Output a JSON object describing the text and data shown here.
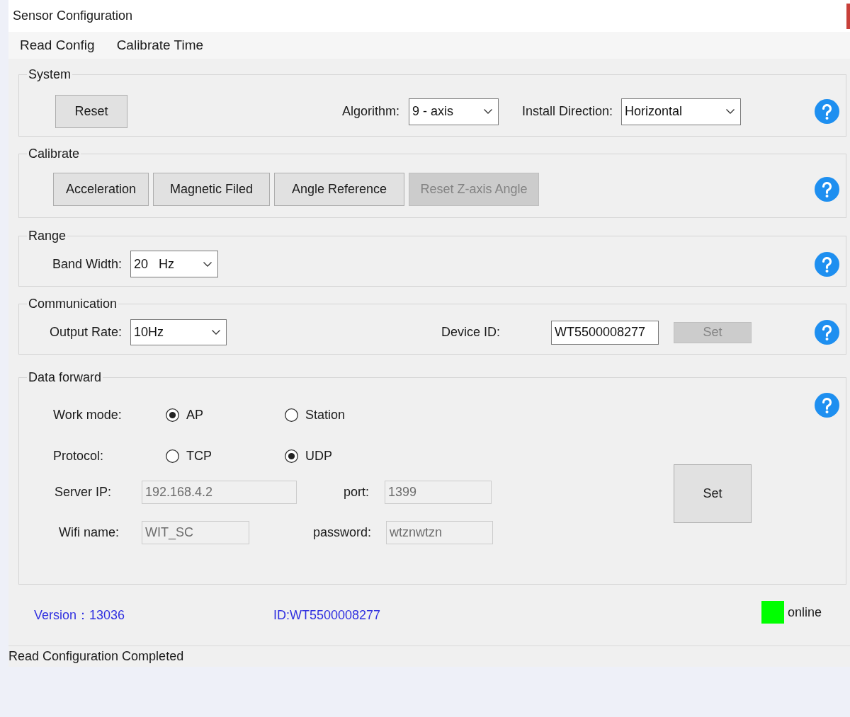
{
  "window": {
    "title": "Sensor Configuration"
  },
  "menu": [
    "Read Config",
    "Calibrate Time"
  ],
  "system": {
    "title": "System",
    "reset_button": {
      "label": "Reset",
      "disabled": false
    },
    "algorithm": {
      "label": "Algorithm:",
      "value": "9 - axis"
    },
    "install_direction": {
      "label": "Install Direction:",
      "value": "Horizontal"
    }
  },
  "calibrate": {
    "title": "Calibrate",
    "buttons": [
      {
        "label": "Acceleration",
        "disabled": false
      },
      {
        "label": "Magnetic Filed",
        "disabled": false
      },
      {
        "label": "Angle Reference",
        "disabled": false
      },
      {
        "label": "Reset Z-axis Angle",
        "disabled": true
      }
    ]
  },
  "range": {
    "title": "Range",
    "band_width": {
      "label": "Band Width:",
      "value": "20   Hz"
    }
  },
  "communication": {
    "title": "Communication",
    "output_rate": {
      "label": "Output Rate:",
      "value": "10Hz"
    },
    "device_id": {
      "label": "Device ID:",
      "value": "WT5500008277",
      "disabled": false
    },
    "set_button": {
      "label": "Set",
      "disabled": true
    }
  },
  "data_forward": {
    "title": "Data forward",
    "work_mode": {
      "label": "Work mode:",
      "options": [
        {
          "label": "AP",
          "selected": true
        },
        {
          "label": "Station",
          "selected": false
        }
      ]
    },
    "protocol": {
      "label": "Protocol:",
      "options": [
        {
          "label": "TCP",
          "selected": false
        },
        {
          "label": "UDP",
          "selected": true
        }
      ]
    },
    "server_ip": {
      "label": "Server IP:",
      "value": "192.168.4.2",
      "disabled": true
    },
    "port": {
      "label": "port:",
      "value": "1399",
      "disabled": true
    },
    "wifi_name": {
      "label": "Wifi name:",
      "value": "WIT_SC",
      "disabled": true
    },
    "password": {
      "label": "password:",
      "value": "wtznwtzn",
      "disabled": true
    },
    "set_button": {
      "label": "Set",
      "disabled": false
    }
  },
  "footer": {
    "version": "Version：13036",
    "device_id": "ID:WT5500008277",
    "connection": {
      "label": "online",
      "color": "#00ff00"
    }
  },
  "status_bar": "Read Configuration Completed"
}
